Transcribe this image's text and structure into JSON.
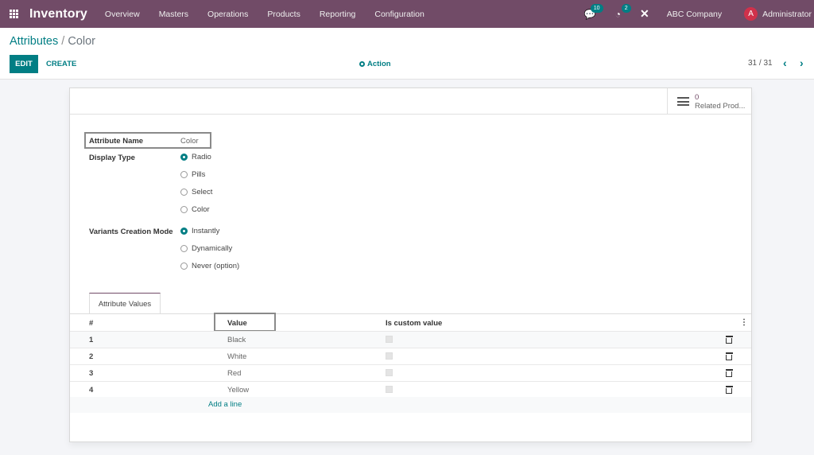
{
  "navbar": {
    "app_name": "Inventory",
    "menu": [
      "Overview",
      "Masters",
      "Operations",
      "Products",
      "Reporting",
      "Configuration"
    ],
    "messages_badge": "10",
    "activities_badge": "2",
    "company": "ABC Company",
    "avatar_letter": "A",
    "user": "Administrator",
    "brand_color": "#714b67"
  },
  "control_panel": {
    "breadcrumb_parent": "Attributes",
    "breadcrumb_separator": "/",
    "breadcrumb_current": "Color",
    "edit_label": "EDIT",
    "create_label": "CREATE",
    "action_label": "Action",
    "pager": "31 / 31",
    "prev_icon": "‹",
    "next_icon": "›"
  },
  "smart_button": {
    "count": "0",
    "label": "Related Prod..."
  },
  "form": {
    "attribute_name_label": "Attribute Name",
    "attribute_name_value": "Color",
    "display_type_label": "Display Type",
    "display_type_options": [
      "Radio",
      "Pills",
      "Select",
      "Color"
    ],
    "display_type_selected": "Radio",
    "variants_label": "Variants Creation Mode",
    "variants_options": [
      "Instantly",
      "Dynamically",
      "Never (option)"
    ],
    "variants_selected": "Instantly"
  },
  "tabs": {
    "attribute_values": "Attribute Values"
  },
  "table": {
    "columns": [
      "#",
      "Value",
      "Is custom value"
    ],
    "rows": [
      {
        "num": "1",
        "value": "Black",
        "is_custom": false
      },
      {
        "num": "2",
        "value": "White",
        "is_custom": false
      },
      {
        "num": "3",
        "value": "Red",
        "is_custom": false
      },
      {
        "num": "4",
        "value": "Yellow",
        "is_custom": false
      }
    ],
    "add_line": "Add a line",
    "kebab_icon": "⋮"
  }
}
